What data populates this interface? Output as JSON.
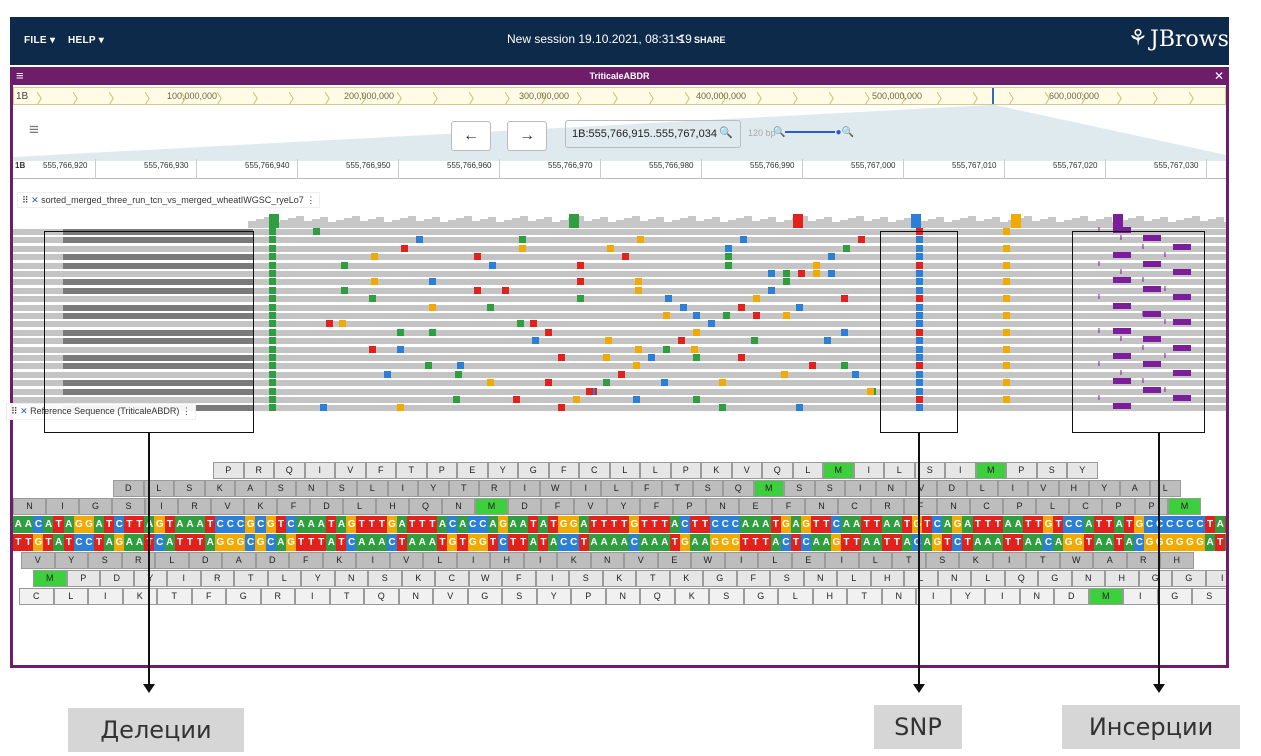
{
  "appbar": {
    "file_menu": "FILE ▾",
    "help_menu": "HELP ▾",
    "session": "New session 19.10.2021, 08:31:19",
    "share_label": "SHARE",
    "brand": "JBrowse"
  },
  "view": {
    "title": "TriticaleABDR",
    "chromosome": "1B",
    "overview_labels": [
      "100,000,000",
      "200,000,000",
      "300,000,000",
      "400,000,000",
      "500,000,000",
      "600,000,000"
    ],
    "location": "1B:555,766,915..555,767,034",
    "bp_label": "120 bp",
    "ruler_chr": "1B",
    "ruler_ticks": [
      "555,766,920",
      "555,766,930",
      "555,766,940",
      "555,766,950",
      "555,766,960",
      "555,766,970",
      "555,766,980",
      "555,766,990",
      "555,767,000",
      "555,767,010",
      "555,767,020",
      "555,767,030"
    ]
  },
  "tracks": {
    "alignment_label": "sorted_merged_three_run_tcn_vs_merged_wheatIWGSC_ryeLo7",
    "reference_label": "Reference Sequence (TriticaleABDR)"
  },
  "annotations": {
    "deletions": "Делеции",
    "snp": "SNP",
    "insertions": "Инсерции"
  },
  "colors": {
    "appbar": "#0e2a4a",
    "view_accent": "#6e1d6a",
    "A": "#2e9e3e",
    "C": "#2c7fd6",
    "G": "#f2a900",
    "T": "#e3211c",
    "stop": "#e8201b",
    "met": "#3ecf3e"
  },
  "sequence": {
    "frame1": "PRQIVFTPEYGFCLLPKVQLMILSIMPSY",
    "frame2": "DLSKASNSLIYTRIWILFTSQMSSINVDLIVHYAL",
    "frame3": "NIGSIRVKFDLHQNMDFVYFPNEFNCRFNCPLCPPM",
    "dna": "AACATAGGATCTTAGTAAATCCCGCGTCAAATAGTTTGATTTACACCAGAATATGGATTTTGTTTACTTCCCAAATGAGTTCAATTAATGTCAGATTTAATTGTCCATTATGCCCCCCTAT",
    "dna_rc": "TTGTATCCTAGAATCATTTAGGGCGCAGTTTATCAAACTAAATGTGGTCTTATACCTAAAACAAATGAAGGGTTTACTCAAGTTAATTACAGTCTAAATTAACAGGTAATACGGGGGGATA",
    "rframe1": "VYSRLDADFKIVLIHIKNVEWILEILTSKITWARH",
    "rframe2": "MPDYIRTLYNSKCWFISKTKGFSNLHLNLQGNHGGI",
    "rframe3": "CLIKTFGRITQNVGSYPNQKSGLHTNIYINDMIGS"
  }
}
